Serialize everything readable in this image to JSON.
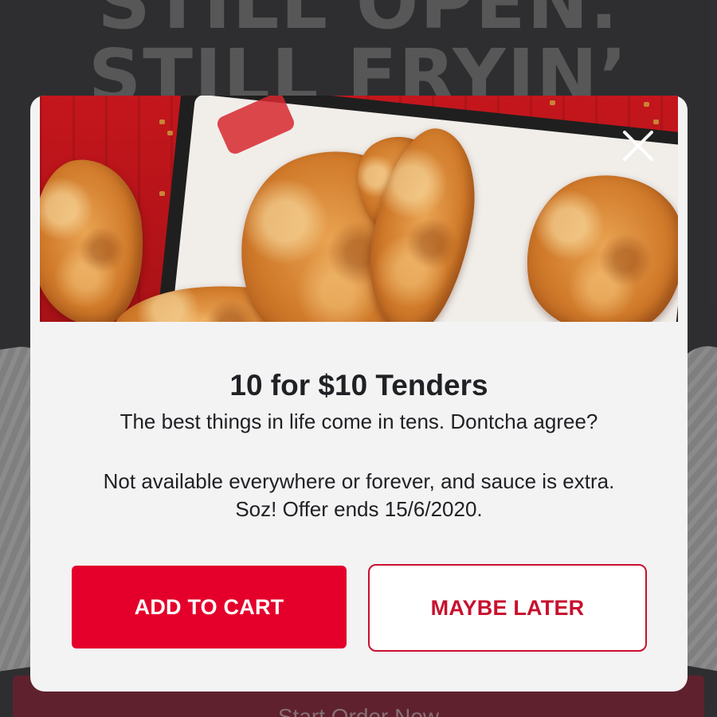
{
  "background": {
    "headline_line1": "STILL OPEN.",
    "headline_line2": "STILL FRYIN’",
    "button_label": "Start Order Now"
  },
  "modal": {
    "title": "10 for $10 Tenders",
    "subtitle": "The best things in life come in tens. Dontcha agree?",
    "disclaimer_line1": "Not available everywhere or forever, and sauce is extra.",
    "disclaimer_line2": "Soz!  Offer ends 15/6/2020.",
    "primary_button": "ADD TO CART",
    "secondary_button": "MAYBE LATER",
    "close_icon": "close-icon",
    "hero_image": "fried-chicken-tenders"
  },
  "colors": {
    "brand_red": "#e4002b",
    "secondary_red": "#c8102e",
    "modal_bg": "#f3f3f4",
    "page_bg": "#323234"
  }
}
